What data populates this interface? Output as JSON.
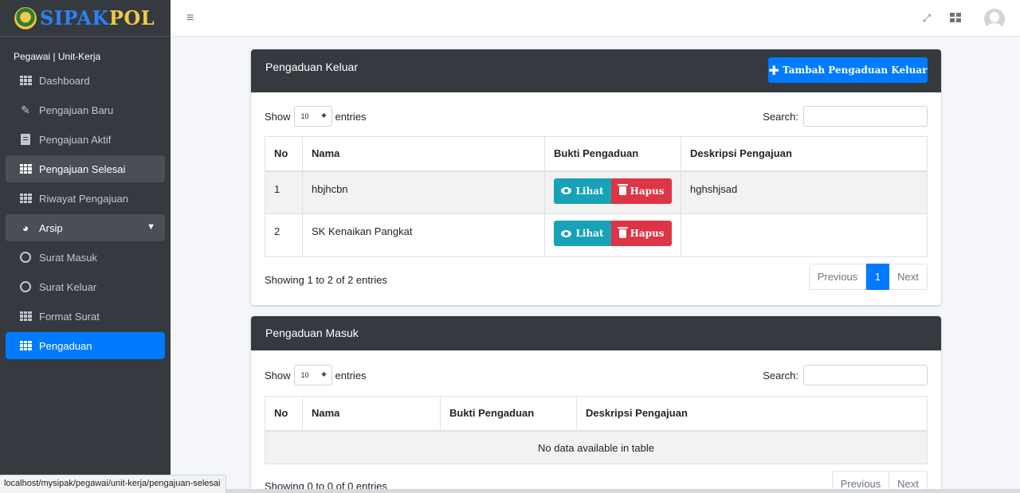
{
  "brand": {
    "part1": "SIPAK",
    "part2": "POL"
  },
  "user": {
    "role": "Pegawai | Unit-Kerja"
  },
  "sidebar": {
    "items": [
      {
        "label": "Dashboard",
        "icon": "grid-icon"
      },
      {
        "label": "Pengajuan Baru",
        "icon": "edit-icon"
      },
      {
        "label": "Pengajuan Aktif",
        "icon": "document-icon"
      },
      {
        "label": "Pengajuan Selesai",
        "icon": "grid-icon"
      },
      {
        "label": "Riwayat Pengajuan",
        "icon": "grid-icon"
      },
      {
        "label": "Arsip",
        "icon": "dashboard-gauge-icon"
      },
      {
        "label": "Surat Masuk",
        "icon": "circle-icon"
      },
      {
        "label": "Surat Keluar",
        "icon": "circle-icon"
      },
      {
        "label": "Format Surat",
        "icon": "grid-icon"
      },
      {
        "label": "Pengaduan",
        "icon": "grid-icon"
      }
    ]
  },
  "topbar": {
    "menu_icon": "≡",
    "expand_icon": "⤢"
  },
  "keluar": {
    "title": "Pengaduan Keluar",
    "add_button": "Tambah Pengaduan Keluar",
    "show_label": "Show",
    "entries_label": "entries",
    "length_value": "10",
    "search_label": "Search:",
    "search_value": "",
    "columns": [
      "No",
      "Nama",
      "Bukti Pengaduan",
      "Deskripsi Pengajuan"
    ],
    "rows": [
      {
        "no": "1",
        "nama": "hbjhcbn",
        "deskripsi": "hghshjsad"
      },
      {
        "no": "2",
        "nama": "SK Kenaikan Pangkat",
        "deskripsi": ""
      }
    ],
    "view_label": "Lihat",
    "delete_label": "Hapus",
    "info": "Showing 1 to 2 of 2 entries",
    "pager": {
      "prev": "Previous",
      "page": "1",
      "next": "Next"
    }
  },
  "masuk": {
    "title": "Pengaduan Masuk",
    "show_label": "Show",
    "entries_label": "entries",
    "length_value": "10",
    "search_label": "Search:",
    "search_value": "",
    "columns": [
      "No",
      "Nama",
      "Bukti Pengaduan",
      "Deskripsi Pengajuan"
    ],
    "empty": "No data available in table",
    "info": "Showing 0 to 0 of 0 entries",
    "pager": {
      "prev": "Previous",
      "next": "Next"
    }
  },
  "status_bar": {
    "url": "localhost/mysipak/pegawai/unit-kerja/pengajuan-selesai"
  },
  "colors": {
    "sidebar": "#343a40",
    "primary": "#007bff",
    "info": "#17a2b8",
    "danger": "#dc3545",
    "brand_blue": "#2f80ed",
    "brand_yellow": "#f2c94c"
  }
}
